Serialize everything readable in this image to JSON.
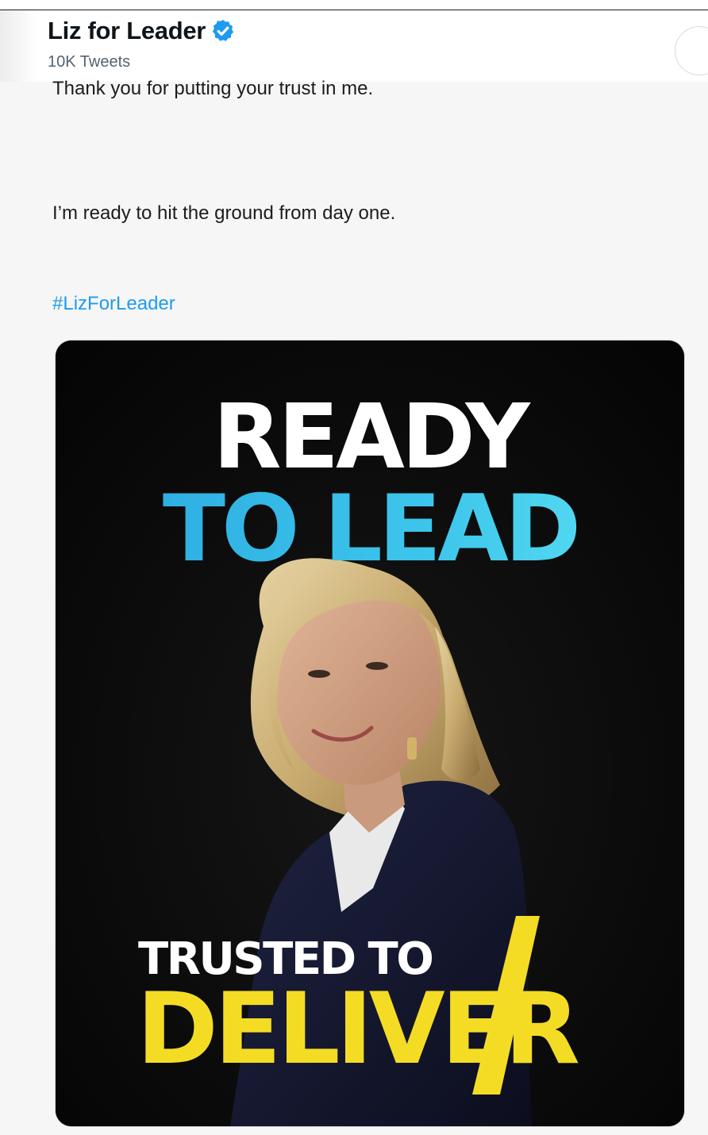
{
  "header": {
    "name": "Liz for Leader",
    "tweet_count": "10K Tweets",
    "verified_icon": "verified-badge-icon"
  },
  "tweet": {
    "line1": "Thank you for putting your trust in me.",
    "line2": "I’m ready to hit the ground from day one.",
    "hashtag": "#LizForLeader"
  },
  "media": {
    "headline_top": "READY",
    "headline_bottom": "TO LEAD",
    "tagline_small": "TRUSTED TO",
    "tagline_big": "DELIVER"
  },
  "colors": {
    "link": "#1d9bf0",
    "verified": "#1d9bf0",
    "headline_blue": "#3dc6ec",
    "tagline_yellow": "#f4dc25",
    "poster_bg": "#080808"
  }
}
